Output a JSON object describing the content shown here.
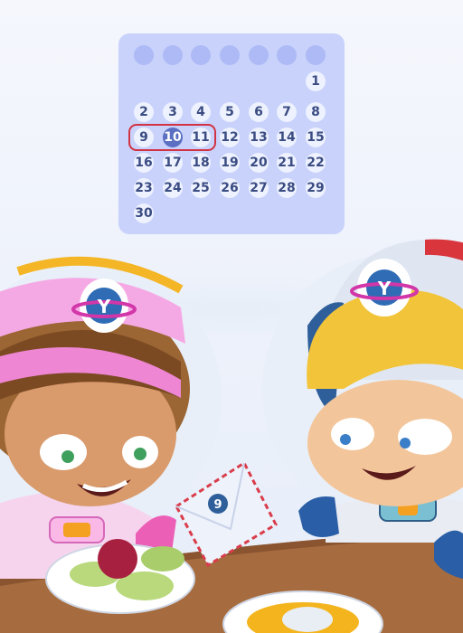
{
  "calendar": {
    "weekday_header_count": 7,
    "days": [
      "1",
      "2",
      "3",
      "4",
      "5",
      "6",
      "7",
      "8",
      "9",
      "10",
      "11",
      "12",
      "13",
      "14",
      "15",
      "16",
      "17",
      "18",
      "19",
      "20",
      "21",
      "22",
      "23",
      "24",
      "25",
      "26",
      "27",
      "28",
      "29",
      "30"
    ],
    "first_day_column": 6,
    "selected_day": "10",
    "highlighted_range": [
      "9",
      "10",
      "11"
    ]
  },
  "scene": {
    "helmet_emblem": "Y",
    "envelope_number": "9"
  },
  "colors": {
    "calendar_bg": "#c8d2fb",
    "day_circle": "#eef2ff",
    "day_text": "#3a4c82",
    "selected_circle": "#5b6fc3",
    "range_border": "#d23344",
    "table": "#a26a3e"
  }
}
